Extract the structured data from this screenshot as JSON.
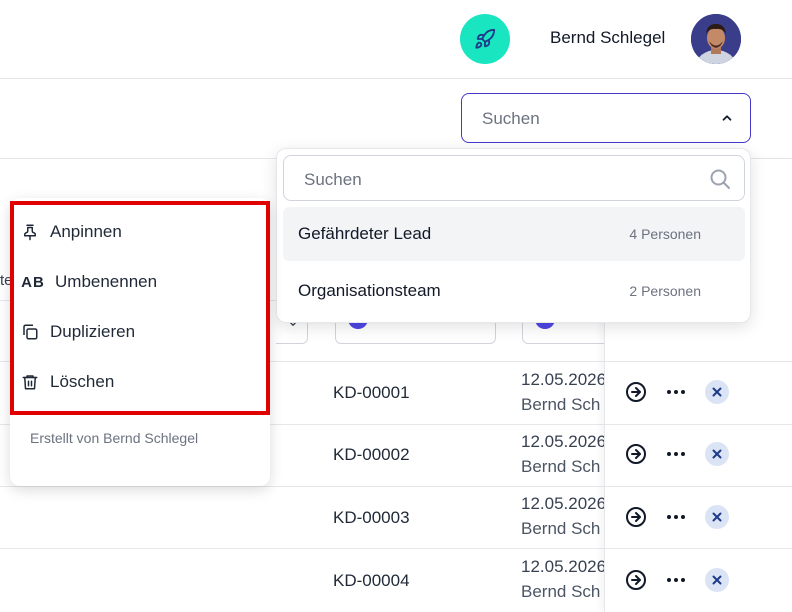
{
  "header": {
    "user_name": "Bernd Schlegel",
    "rocket_icon": "rocket-icon",
    "accent_color": "#19e6c1"
  },
  "search_select": {
    "placeholder": "Suchen"
  },
  "popover": {
    "search_placeholder": "Suchen",
    "items": [
      {
        "label": "Gefährdeter Lead",
        "count": "4 Personen"
      },
      {
        "label": "Organisationsteam",
        "count": "2 Personen"
      }
    ]
  },
  "context_menu": {
    "items": [
      {
        "label": "Anpinnen",
        "icon": "pin-icon"
      },
      {
        "label": "Umbenennen",
        "icon": "rename-ab-icon"
      },
      {
        "label": "Duplizieren",
        "icon": "copy-icon"
      },
      {
        "label": "Löschen",
        "icon": "trash-icon"
      }
    ],
    "footer": "Erstellt von Bernd Schlegel",
    "highlight_color": "#e00000"
  },
  "table": {
    "partial_header": "tе",
    "rows": [
      {
        "id": "KD-00001",
        "date": "12.05.2026",
        "user": "Bernd Sch"
      },
      {
        "id": "KD-00002",
        "date": "12.05.2026",
        "user": "Bernd Sch"
      },
      {
        "id": "KD-00003",
        "date": "12.05.2026",
        "user": "Bernd Sch"
      },
      {
        "id": "KD-00004",
        "date": "12.05.2026",
        "user": "Bernd Sch"
      }
    ]
  }
}
